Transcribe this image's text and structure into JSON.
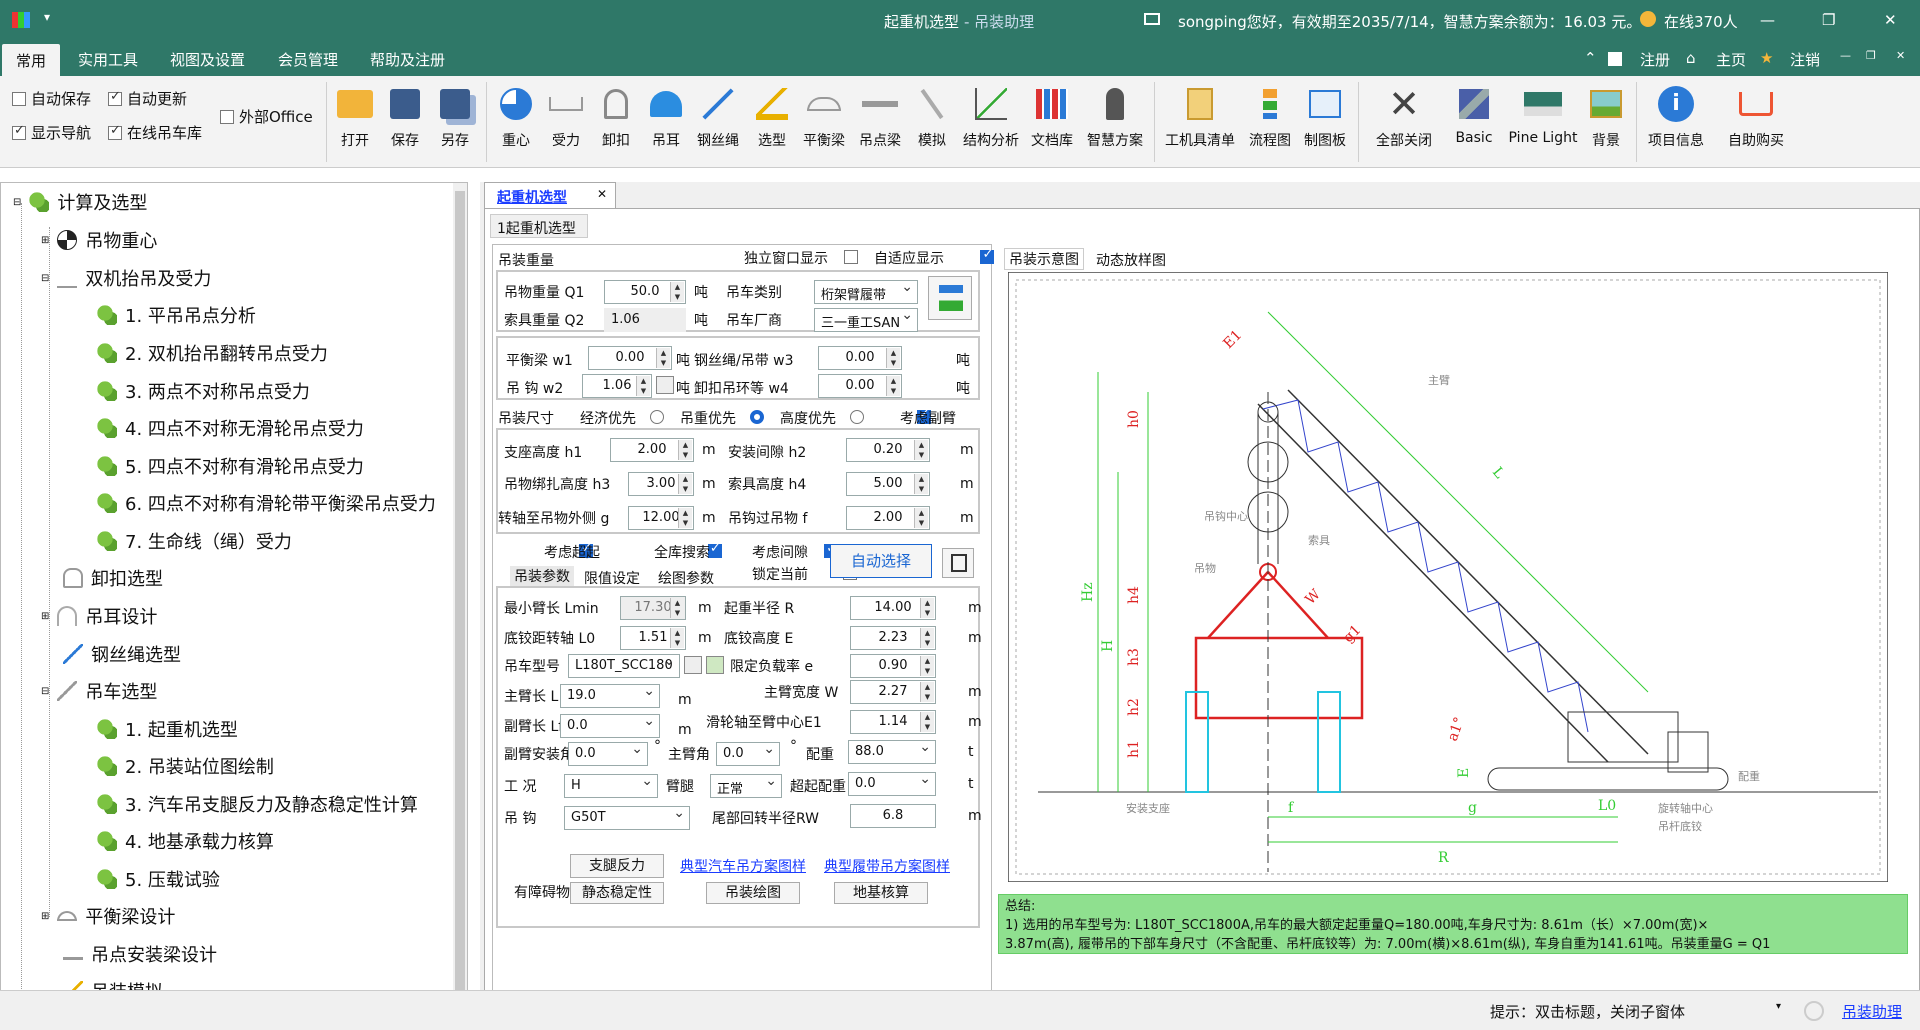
{
  "window": {
    "title": "起重机选型",
    "subtitle": " - 吊装助理",
    "user_info": "songping您好，有效期至2035/7/14，智慧方案余额为：16.03 元。",
    "online": "在线370人",
    "minimize": "—",
    "restore": "❐",
    "close": "✕"
  },
  "menu": {
    "tabs": [
      "常用",
      "实用工具",
      "视图及设置",
      "会员管理",
      "帮助及注册"
    ],
    "right": [
      "注册",
      "主页",
      "注销"
    ]
  },
  "ribbon": {
    "checks": [
      {
        "label": "自动保存",
        "checked": false
      },
      {
        "label": "自动更新",
        "checked": true
      },
      {
        "label": "外部Office",
        "checked": false
      },
      {
        "label": "显示导航",
        "checked": true
      },
      {
        "label": "在线吊车库",
        "checked": true
      }
    ],
    "buttons": [
      "打开",
      "保存",
      "另存",
      "重心",
      "受力",
      "卸扣",
      "吊耳",
      "钢丝绳",
      "选型",
      "平衡梁",
      "吊点梁",
      "模拟",
      "结构分析",
      "文档库",
      "智慧方案",
      "工机具清单",
      "流程图",
      "制图板",
      "全部关闭",
      "Basic",
      "Pine Light",
      "背景",
      "项目信息",
      "自助购买"
    ]
  },
  "tree": {
    "items": [
      {
        "label": "计算及选型",
        "level": 0
      },
      {
        "label": "吊物重心",
        "level": 1
      },
      {
        "label": "双机抬吊及受力",
        "level": 1
      },
      {
        "label": "1. 平吊吊点分析",
        "level": 2
      },
      {
        "label": "2. 双机抬吊翻转吊点受力",
        "level": 2
      },
      {
        "label": "3. 两点不对称吊点受力",
        "level": 2
      },
      {
        "label": "4. 四点不对称无滑轮吊点受力",
        "level": 2
      },
      {
        "label": "5. 四点不对称有滑轮吊点受力",
        "level": 2
      },
      {
        "label": "6. 四点不对称有滑轮带平衡梁吊点受力",
        "level": 2
      },
      {
        "label": "7. 生命线（绳）受力",
        "level": 2
      },
      {
        "label": "卸扣选型",
        "level": 1
      },
      {
        "label": "吊耳设计",
        "level": 1
      },
      {
        "label": "钢丝绳选型",
        "level": 1
      },
      {
        "label": "吊车选型",
        "level": 1
      },
      {
        "label": "1. 起重机选型",
        "level": 2
      },
      {
        "label": "2. 吊装站位图绘制",
        "level": 2
      },
      {
        "label": "3. 汽车吊支腿反力及静态稳定性计算",
        "level": 2
      },
      {
        "label": "4. 地基承载力核算",
        "level": 2
      },
      {
        "label": "5. 压载试验",
        "level": 2
      },
      {
        "label": "平衡梁设计",
        "level": 1
      },
      {
        "label": "吊点安装梁设计",
        "level": 1
      },
      {
        "label": "吊装模拟",
        "level": 1
      }
    ]
  },
  "doc": {
    "tab": "起重机选型",
    "subtab": "1起重机选型",
    "weight": {
      "header": "吊装重量",
      "standalone": "独立窗口显示",
      "adaptive": "自适应显示",
      "q1_label": "吊物重量 Q1",
      "q1": "50.0",
      "unit_t": "吨",
      "q2_label": "索具重量 Q2",
      "q2": "1.06",
      "crane_type_label": "吊车类别",
      "crane_type": "桁架臂履带",
      "maker_label": "吊车厂商",
      "maker": "三一重工SAN",
      "w1_label": "平衡梁 w1",
      "w1": "0.00",
      "w2_label": "吊 钩 w2",
      "w2": "1.06",
      "w3_label": "钢丝绳/吊带 w3",
      "w3": "0.00",
      "w4_label": "卸扣吊环等 w4",
      "w4": "0.00"
    },
    "size": {
      "header": "吊装尺寸",
      "opt1": "经济优先",
      "opt2": "吊重优先",
      "opt3": "高度优先",
      "opt4": "考虑副臂",
      "h1_label": "支座高度 h1",
      "h1": "2.00",
      "h2_label": "安装间隙 h2",
      "h2": "0.20",
      "h3_label": "吊物绑扎高度 h3",
      "h3": "3.00",
      "h4_label": "索具高度 h4",
      "h4": "5.00",
      "g_label": "转轴至吊物外侧 g",
      "g": "12.00",
      "f_label": "吊钩过吊物 f",
      "f": "2.00",
      "unit_m": "m"
    },
    "opts": {
      "c1": "考虑超起",
      "c2": "全库搜索",
      "c3": "考虑间隙",
      "c4": "锁定当前",
      "tabs": [
        "吊装参数",
        "限值设定",
        "绘图参数"
      ],
      "auto_btn": "自动选择"
    },
    "params": {
      "lmin_label": "最小臂长 Lmin",
      "lmin": "17.30",
      "r_label": "起重半径 R",
      "r": "14.00",
      "l0_label": "底铰距转轴 L0",
      "l0": "1.51",
      "e_label": "底铰高度 E",
      "e": "2.23",
      "model_label": "吊车型号",
      "model": "L180T_SCC180",
      "load_label": "限定负载率 e",
      "load": "0.90",
      "l_label": "主臂长 L",
      "l": "19.0",
      "w_label": "主臂宽度 W",
      "w": "2.27",
      "lf_label": "副臂长 Lf",
      "lf": "0.0",
      "e1_label": "滑轮轴至臂中心E1",
      "e1": "1.14",
      "ang_label": "副臂安装角",
      "ang": "0.0",
      "main_ang_label": "主臂角",
      "main_ang": "0.0",
      "cw_label": "配重",
      "cw": "88.0",
      "unit_t": "t",
      "cond_label": "工 况",
      "cond": "H",
      "leg_label": "臂腿",
      "leg": "正常",
      "super_label": "超起配重",
      "super": "0.0",
      "hook_label": "吊 钩",
      "hook": "G50T",
      "tail_label": "尾部回转半径RW",
      "tail": "6.8",
      "deg": "°"
    },
    "bottom": {
      "b1": "支腿反力",
      "b2": "静态稳定性",
      "b3": "吊装绘图",
      "b4": "地基核算",
      "link1": "典型汽车吊方案图样",
      "link2": "典型履带吊方案图样",
      "obstacle": "有障碍物"
    },
    "view_tabs": [
      "吊装示意图",
      "动态放样图"
    ],
    "diagram": {
      "labels": [
        "E1",
        "主臂",
        "吊钩中心",
        "索具",
        "吊物",
        "L",
        "W",
        "g1",
        "h0",
        "Hz",
        "H",
        "h4",
        "h3",
        "h2",
        "h1",
        "E",
        "a1°",
        "L0",
        "f",
        "g",
        "R",
        "安装支座",
        "旋转轴中心",
        "吊杆底铰",
        "配重"
      ]
    },
    "summary": {
      "title": "总结:",
      "line1": "  1) 选用的吊车型号为: L180T_SCC1800A,吊车的最大额定起重量Q=180.00吨,车身尺寸为: 8.61m（长）×7.00m(宽)×",
      "line2": "3.87m(高), 履带吊的下部车身尺寸（不含配重、吊杆底铰等）为: 7.00m(横)×8.61m(纵), 车身自重为141.61吨。吊装重量G = Q1"
    }
  },
  "status": {
    "hint": "提示：双击标题，关闭子窗体",
    "help": "吊装助理"
  }
}
